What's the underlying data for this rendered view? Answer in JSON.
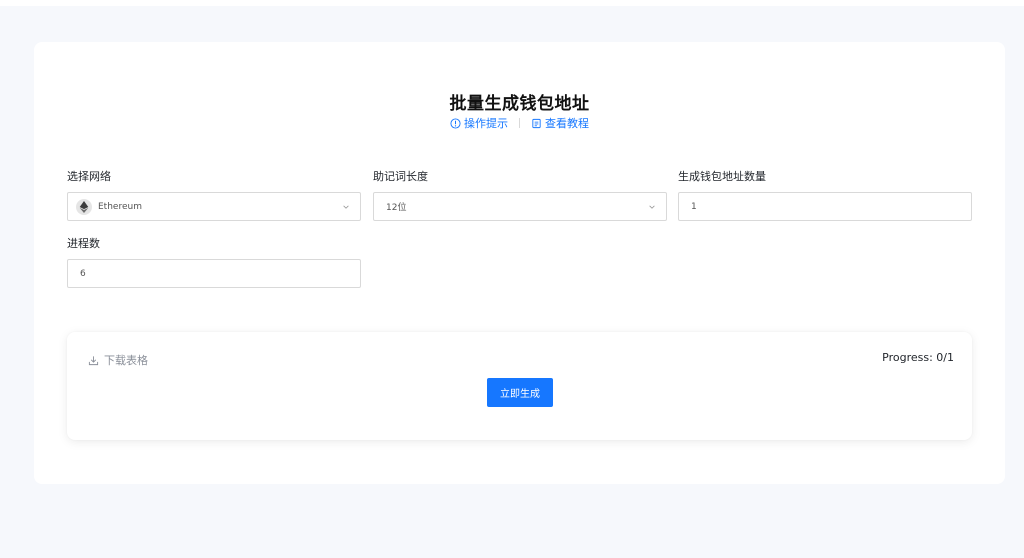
{
  "header": {
    "title": "批量生成钱包地址",
    "tips_link": "操作提示",
    "tutorial_link": "查看教程"
  },
  "form": {
    "network": {
      "label": "选择网络",
      "value": "Ethereum"
    },
    "mnemonic_length": {
      "label": "助记词长度",
      "value": "12位"
    },
    "address_count": {
      "label": "生成钱包地址数量",
      "value": "1"
    },
    "process_count": {
      "label": "进程数",
      "value": "6"
    }
  },
  "panel": {
    "download_label": "下载表格",
    "progress_text": "Progress: 0/1",
    "generate_button": "立即生成"
  },
  "colors": {
    "accent": "#1677ff",
    "background": "#f6f8fc"
  }
}
